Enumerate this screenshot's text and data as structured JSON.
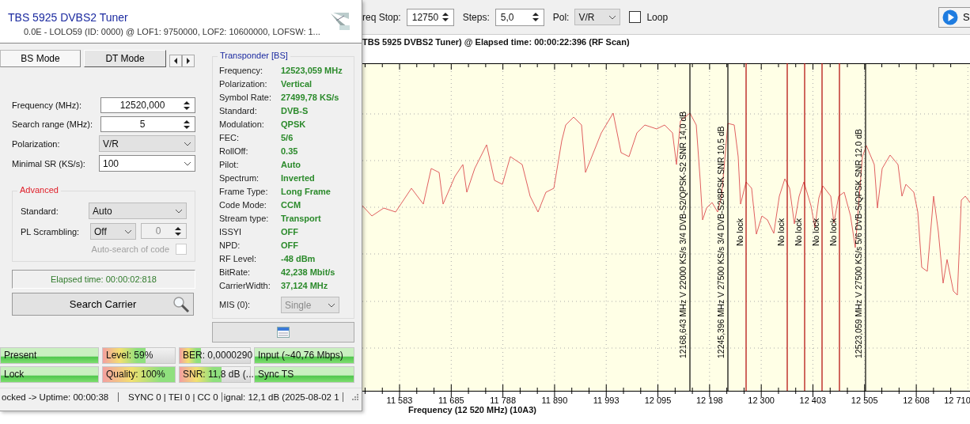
{
  "tuner_window": {
    "title": "TBS 5925 DVBS2 Tuner",
    "subtitle": "0.0E - LOLO59 (ID: 0000) @ LOF1: 9750000, LOF2: 10600000, LOFSW: 1...",
    "tabs": [
      {
        "label": "BS Mode",
        "selected": true
      },
      {
        "label": "DT Mode",
        "selected": false
      }
    ],
    "fields": [
      {
        "kind": "spin",
        "label": "Frequency (MHz):",
        "value": "12520,000"
      },
      {
        "kind": "spin",
        "label": "Search range (MHz):",
        "value": "5"
      },
      {
        "kind": "select",
        "label": "Polarization:",
        "value": "V/R"
      },
      {
        "kind": "combo",
        "label": "Minimal SR (KS/s):",
        "value": "100"
      }
    ],
    "advanced": {
      "title": "Advanced",
      "standard": {
        "label": "Standard:",
        "value": "Auto"
      },
      "pl_scrambling": {
        "label": "PL Scrambling:",
        "value": "Off",
        "code": "0"
      },
      "auto_search": {
        "label": "Auto-search of code",
        "checked": false,
        "disabled": true
      }
    },
    "elapsed": "Elapsed time: 00:00:02:818",
    "search_button": "Search Carrier",
    "transponder": {
      "title": "Transponder [BS]",
      "rows": [
        {
          "label": "Frequency:",
          "value": "12523,059 MHz"
        },
        {
          "label": "Polarization:",
          "value": "Vertical"
        },
        {
          "label": "Symbol Rate:",
          "value": "27499,78 KS/s"
        },
        {
          "label": "Standard:",
          "value": "DVB-S"
        },
        {
          "label": "Modulation:",
          "value": "QPSK"
        },
        {
          "label": "FEC:",
          "value": "5/6"
        },
        {
          "label": "RollOff:",
          "value": "0.35"
        },
        {
          "label": "Pilot:",
          "value": "Auto"
        },
        {
          "label": "Spectrum:",
          "value": "Inverted"
        },
        {
          "label": "Frame Type:",
          "value": "Long Frame"
        },
        {
          "label": "Code Mode:",
          "value": "CCM"
        },
        {
          "label": "Stream type:",
          "value": "Transport"
        },
        {
          "label": "ISSYI",
          "value": "OFF"
        },
        {
          "label": "NPD:",
          "value": "OFF"
        },
        {
          "label": "RF Level:",
          "value": "-48 dBm"
        },
        {
          "label": "BitRate:",
          "value": "42,238 Mbit/s"
        },
        {
          "label": "CarrierWidth:",
          "value": "37,124 MHz"
        }
      ],
      "mis": {
        "label": "MIS (0):",
        "value": "Single"
      }
    },
    "meters": [
      {
        "kind": "state",
        "label": "Present",
        "level": 1
      },
      {
        "kind": "meter",
        "label": "Level: 59%",
        "level": 0.59
      },
      {
        "kind": "meter",
        "label": "BER: 0,0000290",
        "level": 0.3
      },
      {
        "kind": "state",
        "label": "Input (~40,76 Mbps)",
        "level": 1
      },
      {
        "kind": "state",
        "label": "Lock",
        "level": 1
      },
      {
        "kind": "meter",
        "label": "Quality: 100%",
        "level": 1
      },
      {
        "kind": "meter",
        "label": "SNR: 11,8 dB (...",
        "level": 0.6
      },
      {
        "kind": "state",
        "label": "Sync TS",
        "level": 1
      }
    ],
    "status_line": [
      "ocked -> Uptime: 00:00:38",
      "SYNC 0 | TEI 0 | CC 0",
      "ignal: 12,1 dB (2025-08-02 1"
    ]
  },
  "scan_toolbar": {
    "fields": [
      {
        "label": "req Stop:",
        "value": "12750"
      },
      {
        "label": "Steps:",
        "value": "5,0"
      }
    ],
    "pol": {
      "label": "Pol:",
      "value": "V/R"
    },
    "loop": {
      "label": "Loop",
      "checked": false
    },
    "start_button": "S"
  },
  "spectrum": {
    "title": "TBS 5925 DVBS2 Tuner) @ Elapsed time: 00:00:22:396 (RF Scan)",
    "markers": [
      {
        "kind": "lock",
        "label": "12168,643 MHz V 22000 KS/s 3/4 DVB-S2/QPSK-S2 SNR 14,0 dB"
      },
      {
        "kind": "lock",
        "label": "12245,396 MHz V 27500 KS/s 3/4 DVB-S2/8PSK SNR 10,5 dB"
      },
      {
        "kind": "nolock",
        "label": "No lock"
      },
      {
        "kind": "nolock",
        "label": "No lock"
      },
      {
        "kind": "nolock",
        "label": "No lock"
      },
      {
        "kind": "nolock",
        "label": "No lock"
      },
      {
        "kind": "nolock",
        "label": "No lock"
      },
      {
        "kind": "lock",
        "label": "12523,059 MHz V 27500 KS/s 5/6 DVB-S/QPSK SNR 12,0 dB"
      }
    ],
    "x_labels": [
      "11 583",
      "11 685",
      "11 788",
      "11 890",
      "11 993",
      "12 095",
      "12 198",
      "12 300",
      "12 403",
      "12 505",
      "12 608",
      "12 710"
    ],
    "x_title": "Frequency (12 520 MHz) (10A3)"
  }
}
